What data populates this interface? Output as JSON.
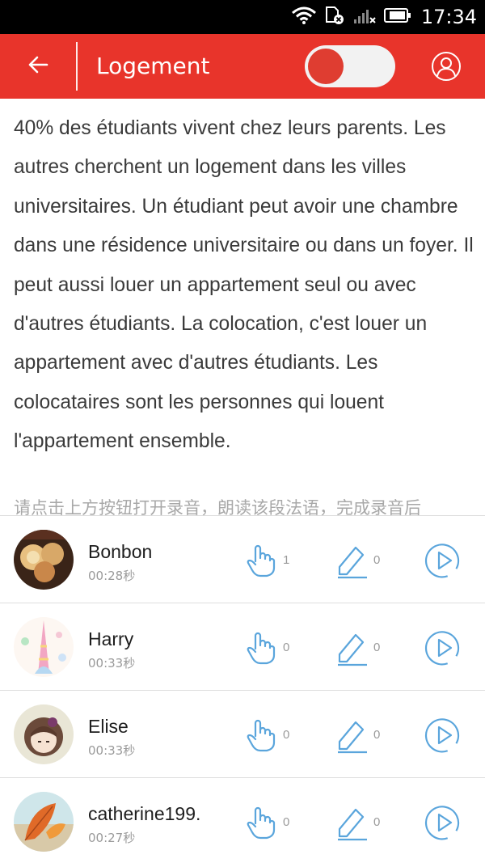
{
  "status_bar": {
    "time": "17:34",
    "icons": [
      "wifi-icon",
      "sim-disabled-icon",
      "signal-icon",
      "battery-icon"
    ]
  },
  "header": {
    "title": "Logement",
    "back_icon": "back-arrow-icon",
    "profile_icon": "user-icon",
    "toggle_on": true,
    "color": "#e8342b"
  },
  "passage": {
    "text": "40% des étudiants vivent chez leurs parents. Les autres cherchent un logement dans les villes universitaires. Un étudiant peut avoir une chambre dans une résidence universitaire ou dans un foyer. Il peut aussi louer un appartement seul ou avec d'autres étudiants. La colocation, c'est louer un appartement avec d'autres étudiants. Les colocataires sont les personnes qui louent l'appartement ensemble."
  },
  "instruction": "请点击上方按钮打开录音，朗读该段法语，完成录音后",
  "recordings": [
    {
      "name": "Bonbon",
      "duration": "00:28秒",
      "likes": "1",
      "comments": "0",
      "avatar": "lanterns-avatar"
    },
    {
      "name": "Harry",
      "duration": "00:33秒",
      "likes": "0",
      "comments": "0",
      "avatar": "eiffel-tower-avatar"
    },
    {
      "name": "Elise",
      "duration": "00:33秒",
      "likes": "0",
      "comments": "0",
      "avatar": "doll-avatar"
    },
    {
      "name": "catherine199.",
      "duration": "00:27秒",
      "likes": "0",
      "comments": "0",
      "avatar": "autumn-leaf-avatar"
    }
  ],
  "accent_color": "#5aa5dc"
}
